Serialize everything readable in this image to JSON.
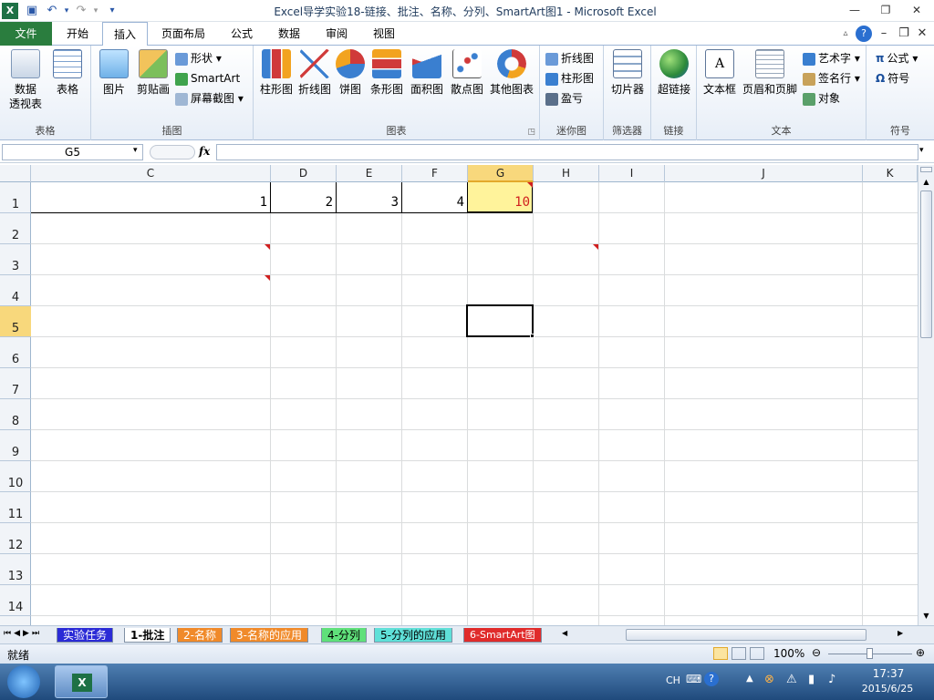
{
  "window": {
    "title": "Excel导学实验18-链接、批注、名称、分列、SmartArt图1 - Microsoft Excel",
    "minimize": "—",
    "restore": "❐",
    "close": "✕"
  },
  "ribbon_tabs": {
    "file": "文件",
    "home": "开始",
    "insert": "插入",
    "layout": "页面布局",
    "formulas": "公式",
    "data": "数据",
    "review": "审阅",
    "view": "视图"
  },
  "groups": {
    "tables": {
      "label": "表格",
      "pivot": "数据\n透视表",
      "table": "表格"
    },
    "illustrations": {
      "label": "插图",
      "picture": "图片",
      "clipart": "剪贴画",
      "shapes": "形状",
      "smartart": "SmartArt",
      "screenshot": "屏幕截图"
    },
    "charts": {
      "label": "图表",
      "column": "柱形图",
      "line": "折线图",
      "pie": "饼图",
      "bar": "条形图",
      "area": "面积图",
      "scatter": "散点图",
      "other": "其他图表"
    },
    "sparklines": {
      "label": "迷你图",
      "line": "折线图",
      "column": "柱形图",
      "winloss": "盈亏"
    },
    "filter": {
      "label": "筛选器",
      "slicer": "切片器"
    },
    "links": {
      "label": "链接",
      "hyperlink": "超链接"
    },
    "text": {
      "label": "文本",
      "textbox": "文本框",
      "headerfooter": "页眉和页脚",
      "wordart": "艺术字",
      "signature": "签名行",
      "object": "对象"
    },
    "symbols": {
      "label": "符号",
      "equation": "公式",
      "symbol": "符号"
    }
  },
  "formula_bar": {
    "name_box": "G5",
    "fx": "fx",
    "formula": ""
  },
  "columns": [
    "C",
    "D",
    "E",
    "F",
    "G",
    "H",
    "I",
    "J",
    "K"
  ],
  "rows": [
    "1",
    "2",
    "3",
    "4",
    "5",
    "6",
    "7",
    "8",
    "9",
    "10",
    "11",
    "12",
    "13",
    "14"
  ],
  "cells": {
    "C1": "1",
    "D1": "2",
    "E1": "3",
    "F1": "4",
    "G1": "10"
  },
  "sheets": [
    "实验任务",
    "1-批注",
    "2-名称",
    "3-名称的应用",
    "4-分列",
    "5-分列的应用",
    "6-SmartArt图"
  ],
  "status": {
    "ready": "就绪",
    "zoom": "100%"
  },
  "taskbar": {
    "lang": "CH",
    "time": "17:37",
    "date": "2015/6/25"
  },
  "colors": {
    "accent": "#2a7d3e",
    "selected_header": "#f8d87c",
    "comment": "#d01f1f"
  }
}
